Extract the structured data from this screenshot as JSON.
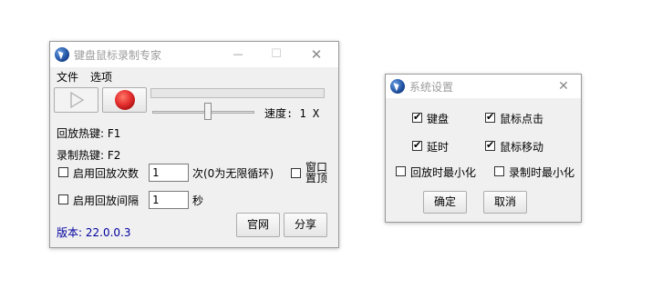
{
  "main_window": {
    "title": "键盘鼠标录制专家",
    "controls": {
      "minimize": "—",
      "maximize": "☐",
      "close": "✕"
    },
    "menu": [
      "文件",
      "选项"
    ],
    "speed_label": "速度: 1 X",
    "playback_hotkey": "回放热键: F1",
    "record_hotkey": "录制热键: F2",
    "repeat_count": {
      "label": "启用回放次数",
      "value": "1",
      "suffix": "次(0为无限循环)",
      "checked": false
    },
    "interval": {
      "label": "启用回放间隔",
      "value": "1",
      "suffix": "秒",
      "checked": false
    },
    "topmost": {
      "label_line1": "窗口",
      "label_line2": "置顶",
      "checked": false
    },
    "version": "版本: 22.0.0.3",
    "website_button": "官网",
    "share_button": "分享",
    "speed_slider_level": 0.55
  },
  "settings_window": {
    "title": "系统设置",
    "close": "✕",
    "options": {
      "keyboard": {
        "label": "键盘",
        "checked": true
      },
      "mouse_click": {
        "label": "鼠标点击",
        "checked": true
      },
      "delay": {
        "label": "延时",
        "checked": true
      },
      "mouse_move": {
        "label": "鼠标移动",
        "checked": true
      },
      "minimize_on_playback": {
        "label": "回放时最小化",
        "checked": false
      },
      "minimize_on_record": {
        "label": "录制时最小化",
        "checked": false
      }
    },
    "ok_button": "确定",
    "cancel_button": "取消"
  },
  "colors": {
    "version_text": "#0000a0",
    "record_red": "#e53030",
    "title_gray": "#9c9c9c"
  }
}
